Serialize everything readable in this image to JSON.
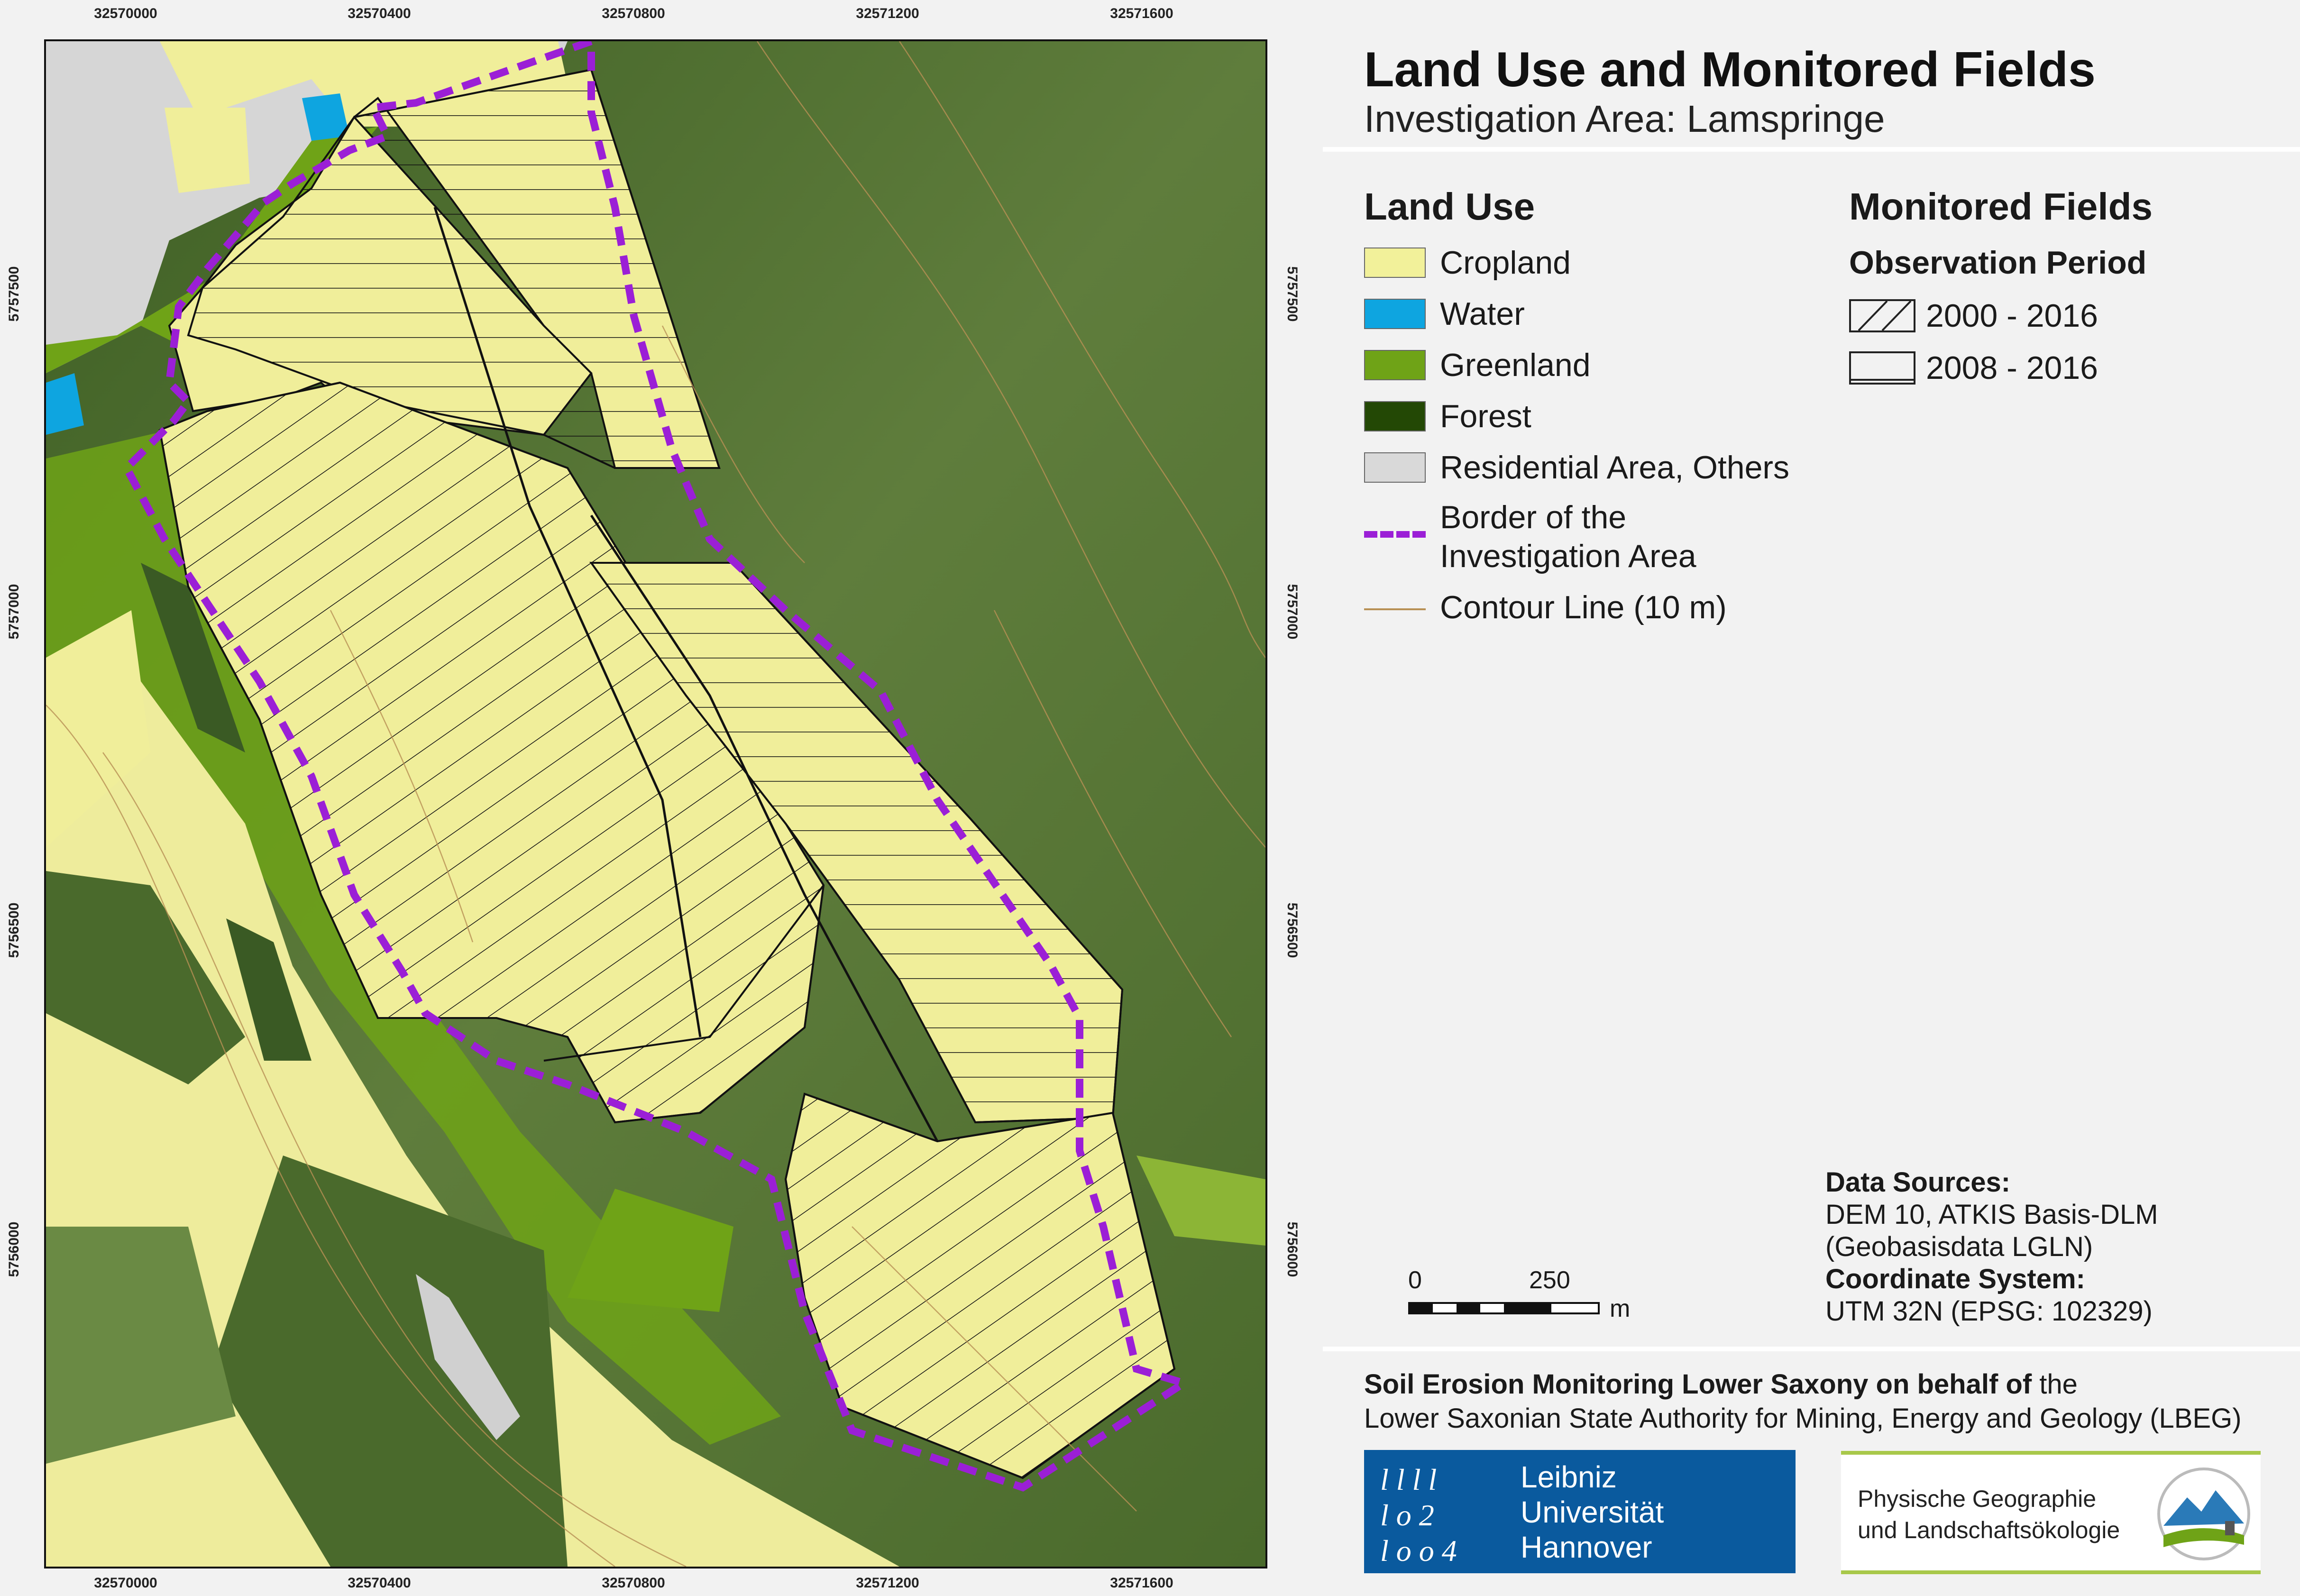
{
  "map": {
    "x_ticks": [
      "32570000",
      "32570400",
      "32570800",
      "32571200",
      "32571600"
    ],
    "y_ticks": [
      "5757500",
      "5757000",
      "5756500",
      "5756000"
    ],
    "colors": {
      "cropland": "#f2f19a",
      "water": "#0ea5e0",
      "greenland": "#6fa317",
      "forest": "#234805",
      "residential": "#d9d9d9",
      "border": "#9b1fd6",
      "contour": "#b89055"
    }
  },
  "header": {
    "title": "Land Use and Monitored Fields",
    "subtitle": "Investigation Area: Lamspringe"
  },
  "legend": {
    "land_use_title": "Land Use",
    "items": [
      {
        "label": "Cropland",
        "color": "#f2f19a"
      },
      {
        "label": "Water",
        "color": "#0ea5e0"
      },
      {
        "label": "Greenland",
        "color": "#6fa317"
      },
      {
        "label": "Forest",
        "color": "#234805"
      },
      {
        "label": "Residential Area, Others",
        "color": "#d9d9d9"
      }
    ],
    "border_label_1": "Border of the",
    "border_label_2": "Investigation Area",
    "contour_label": "Contour Line (10 m)",
    "monitored_title": "Monitored Fields",
    "period_title": "Observation Period",
    "period_1": "2000 - 2016",
    "period_2": "2008 - 2016"
  },
  "scale_bar": {
    "start": "0",
    "end": "250",
    "unit": "m"
  },
  "sources": {
    "title": "Data Sources:",
    "line1": "DEM 10, ATKIS Basis-DLM",
    "line2": "(Geobasisdata LGLN)",
    "crs_title": "Coordinate System:",
    "crs": "UTM 32N (EPSG: 102329)"
  },
  "footer": {
    "line1_bold": "Soil Erosion Monitoring Lower Saxony on behalf of",
    "line1_rest": " the",
    "line2": "Lower Saxonian State Authority for Mining, Energy and Geology (LBEG)",
    "luh_1": "Leibniz",
    "luh_2": "Universität",
    "luh_3": "Hannover",
    "pg_1": "Physische Geographie",
    "pg_2": "und Landschaftsökologie"
  }
}
